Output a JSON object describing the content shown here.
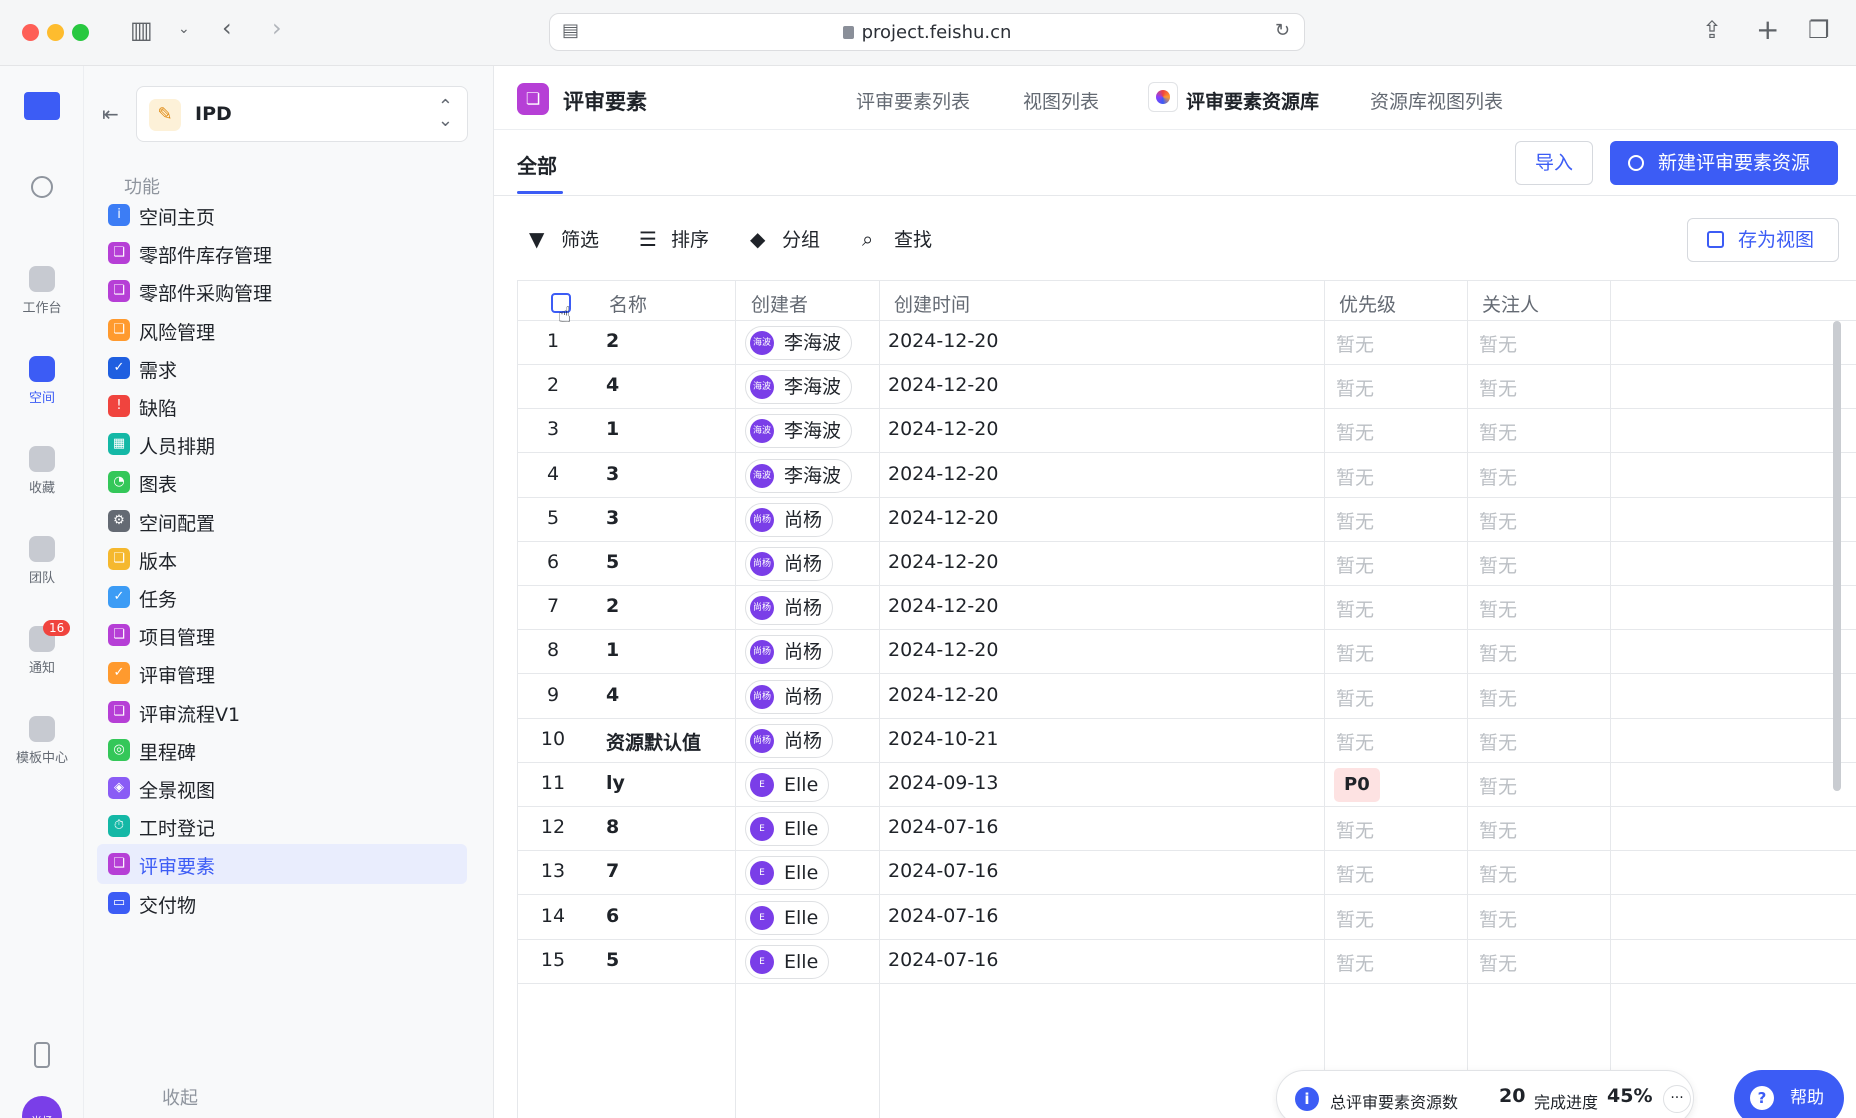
{
  "browser": {
    "url": "project.feishu.cn"
  },
  "rail": {
    "items": [
      {
        "label": "工作台",
        "icon": "home-icon"
      },
      {
        "label": "空间",
        "icon": "space-icon",
        "active": true
      },
      {
        "label": "收藏",
        "icon": "star-icon"
      },
      {
        "label": "团队",
        "icon": "team-icon"
      },
      {
        "label": "通知",
        "icon": "bell-icon",
        "badge": "16"
      },
      {
        "label": "模板中心",
        "icon": "template-icon"
      }
    ],
    "avatar": "尚杨"
  },
  "sidebar": {
    "space_name": "IPD",
    "section_functions": "功能",
    "section_collapsed": "收起",
    "items": [
      {
        "label": "空间主页",
        "color": "#3c7df5",
        "glyph": "i"
      },
      {
        "label": "零部件库存管理",
        "color": "#b63fd6",
        "glyph": "❏"
      },
      {
        "label": "零部件采购管理",
        "color": "#b63fd6",
        "glyph": "❏"
      },
      {
        "label": "风险管理",
        "color": "#ff9a2e",
        "glyph": "❏"
      },
      {
        "label": "需求",
        "color": "#1f5fe0",
        "glyph": "✓"
      },
      {
        "label": "缺陷",
        "color": "#f0443e",
        "glyph": "!"
      },
      {
        "label": "人员排期",
        "color": "#14b8a6",
        "glyph": "▦"
      },
      {
        "label": "图表",
        "color": "#34c759",
        "glyph": "◔"
      },
      {
        "label": "空间配置",
        "color": "#646a73",
        "glyph": "⚙"
      },
      {
        "label": "版本",
        "color": "#f5b82e",
        "glyph": "❏"
      },
      {
        "label": "任务",
        "color": "#3c9cf5",
        "glyph": "✓"
      },
      {
        "label": "项目管理",
        "color": "#b63fd6",
        "glyph": "❏"
      },
      {
        "label": "评审管理",
        "color": "#ff9a2e",
        "glyph": "✓"
      },
      {
        "label": "评审流程V1",
        "color": "#b63fd6",
        "glyph": "❏"
      },
      {
        "label": "里程碑",
        "color": "#34c759",
        "glyph": "◎"
      },
      {
        "label": "全景视图",
        "color": "#8a5cf5",
        "glyph": "◈"
      },
      {
        "label": "工时登记",
        "color": "#14b8a6",
        "glyph": "⏱"
      },
      {
        "label": "评审要素",
        "color": "#b63fd6",
        "glyph": "❏",
        "active": true
      },
      {
        "label": "交付物",
        "color": "#3c5cf5",
        "glyph": "▭"
      }
    ]
  },
  "header": {
    "title": "评审要素",
    "tabs": [
      "评审要素列表",
      "视图列表",
      "评审要素资源库",
      "资源库视图列表"
    ]
  },
  "subbar": {
    "tab_all": "全部",
    "import_label": "导入",
    "new_label": "新建评审要素资源"
  },
  "toolbar": {
    "filter": "筛选",
    "sort": "排序",
    "group": "分组",
    "find": "查找",
    "save_view": "存为视图"
  },
  "table": {
    "columns": [
      "名称",
      "创建者",
      "创建时间",
      "优先级",
      "关注人"
    ],
    "rows": [
      {
        "idx": "1",
        "name": "2",
        "creator": "李海波",
        "avatar": "海波",
        "date": "2024-12-20",
        "priority": "暂无",
        "watcher": "暂无"
      },
      {
        "idx": "2",
        "name": "4",
        "creator": "李海波",
        "avatar": "海波",
        "date": "2024-12-20",
        "priority": "暂无",
        "watcher": "暂无"
      },
      {
        "idx": "3",
        "name": "1",
        "creator": "李海波",
        "avatar": "海波",
        "date": "2024-12-20",
        "priority": "暂无",
        "watcher": "暂无"
      },
      {
        "idx": "4",
        "name": "3",
        "creator": "李海波",
        "avatar": "海波",
        "date": "2024-12-20",
        "priority": "暂无",
        "watcher": "暂无"
      },
      {
        "idx": "5",
        "name": "3",
        "creator": "尚杨",
        "avatar": "尚杨",
        "date": "2024-12-20",
        "priority": "暂无",
        "watcher": "暂无"
      },
      {
        "idx": "6",
        "name": "5",
        "creator": "尚杨",
        "avatar": "尚杨",
        "date": "2024-12-20",
        "priority": "暂无",
        "watcher": "暂无"
      },
      {
        "idx": "7",
        "name": "2",
        "creator": "尚杨",
        "avatar": "尚杨",
        "date": "2024-12-20",
        "priority": "暂无",
        "watcher": "暂无"
      },
      {
        "idx": "8",
        "name": "1",
        "creator": "尚杨",
        "avatar": "尚杨",
        "date": "2024-12-20",
        "priority": "暂无",
        "watcher": "暂无"
      },
      {
        "idx": "9",
        "name": "4",
        "creator": "尚杨",
        "avatar": "尚杨",
        "date": "2024-12-20",
        "priority": "暂无",
        "watcher": "暂无"
      },
      {
        "idx": "10",
        "name": "资源默认值",
        "creator": "尚杨",
        "avatar": "尚杨",
        "date": "2024-10-21",
        "priority": "暂无",
        "watcher": "暂无"
      },
      {
        "idx": "11",
        "name": "ly",
        "creator": "Elle",
        "avatar": "E",
        "date": "2024-09-13",
        "priority": "P0",
        "watcher": "暂无"
      },
      {
        "idx": "12",
        "name": "8",
        "creator": "Elle",
        "avatar": "E",
        "date": "2024-07-16",
        "priority": "暂无",
        "watcher": "暂无"
      },
      {
        "idx": "13",
        "name": "7",
        "creator": "Elle",
        "avatar": "E",
        "date": "2024-07-16",
        "priority": "暂无",
        "watcher": "暂无"
      },
      {
        "idx": "14",
        "name": "6",
        "creator": "Elle",
        "avatar": "E",
        "date": "2024-07-16",
        "priority": "暂无",
        "watcher": "暂无"
      },
      {
        "idx": "15",
        "name": "5",
        "creator": "Elle",
        "avatar": "E",
        "date": "2024-07-16",
        "priority": "暂无",
        "watcher": "暂无"
      }
    ]
  },
  "status": {
    "total_label": "总评审要素资源数",
    "total_value": "20",
    "progress_label": "完成进度",
    "progress_value": "45%"
  },
  "help_label": "帮助",
  "colors": {
    "accent": "#3c5cf5",
    "p0_tag": "#fde2e2"
  }
}
